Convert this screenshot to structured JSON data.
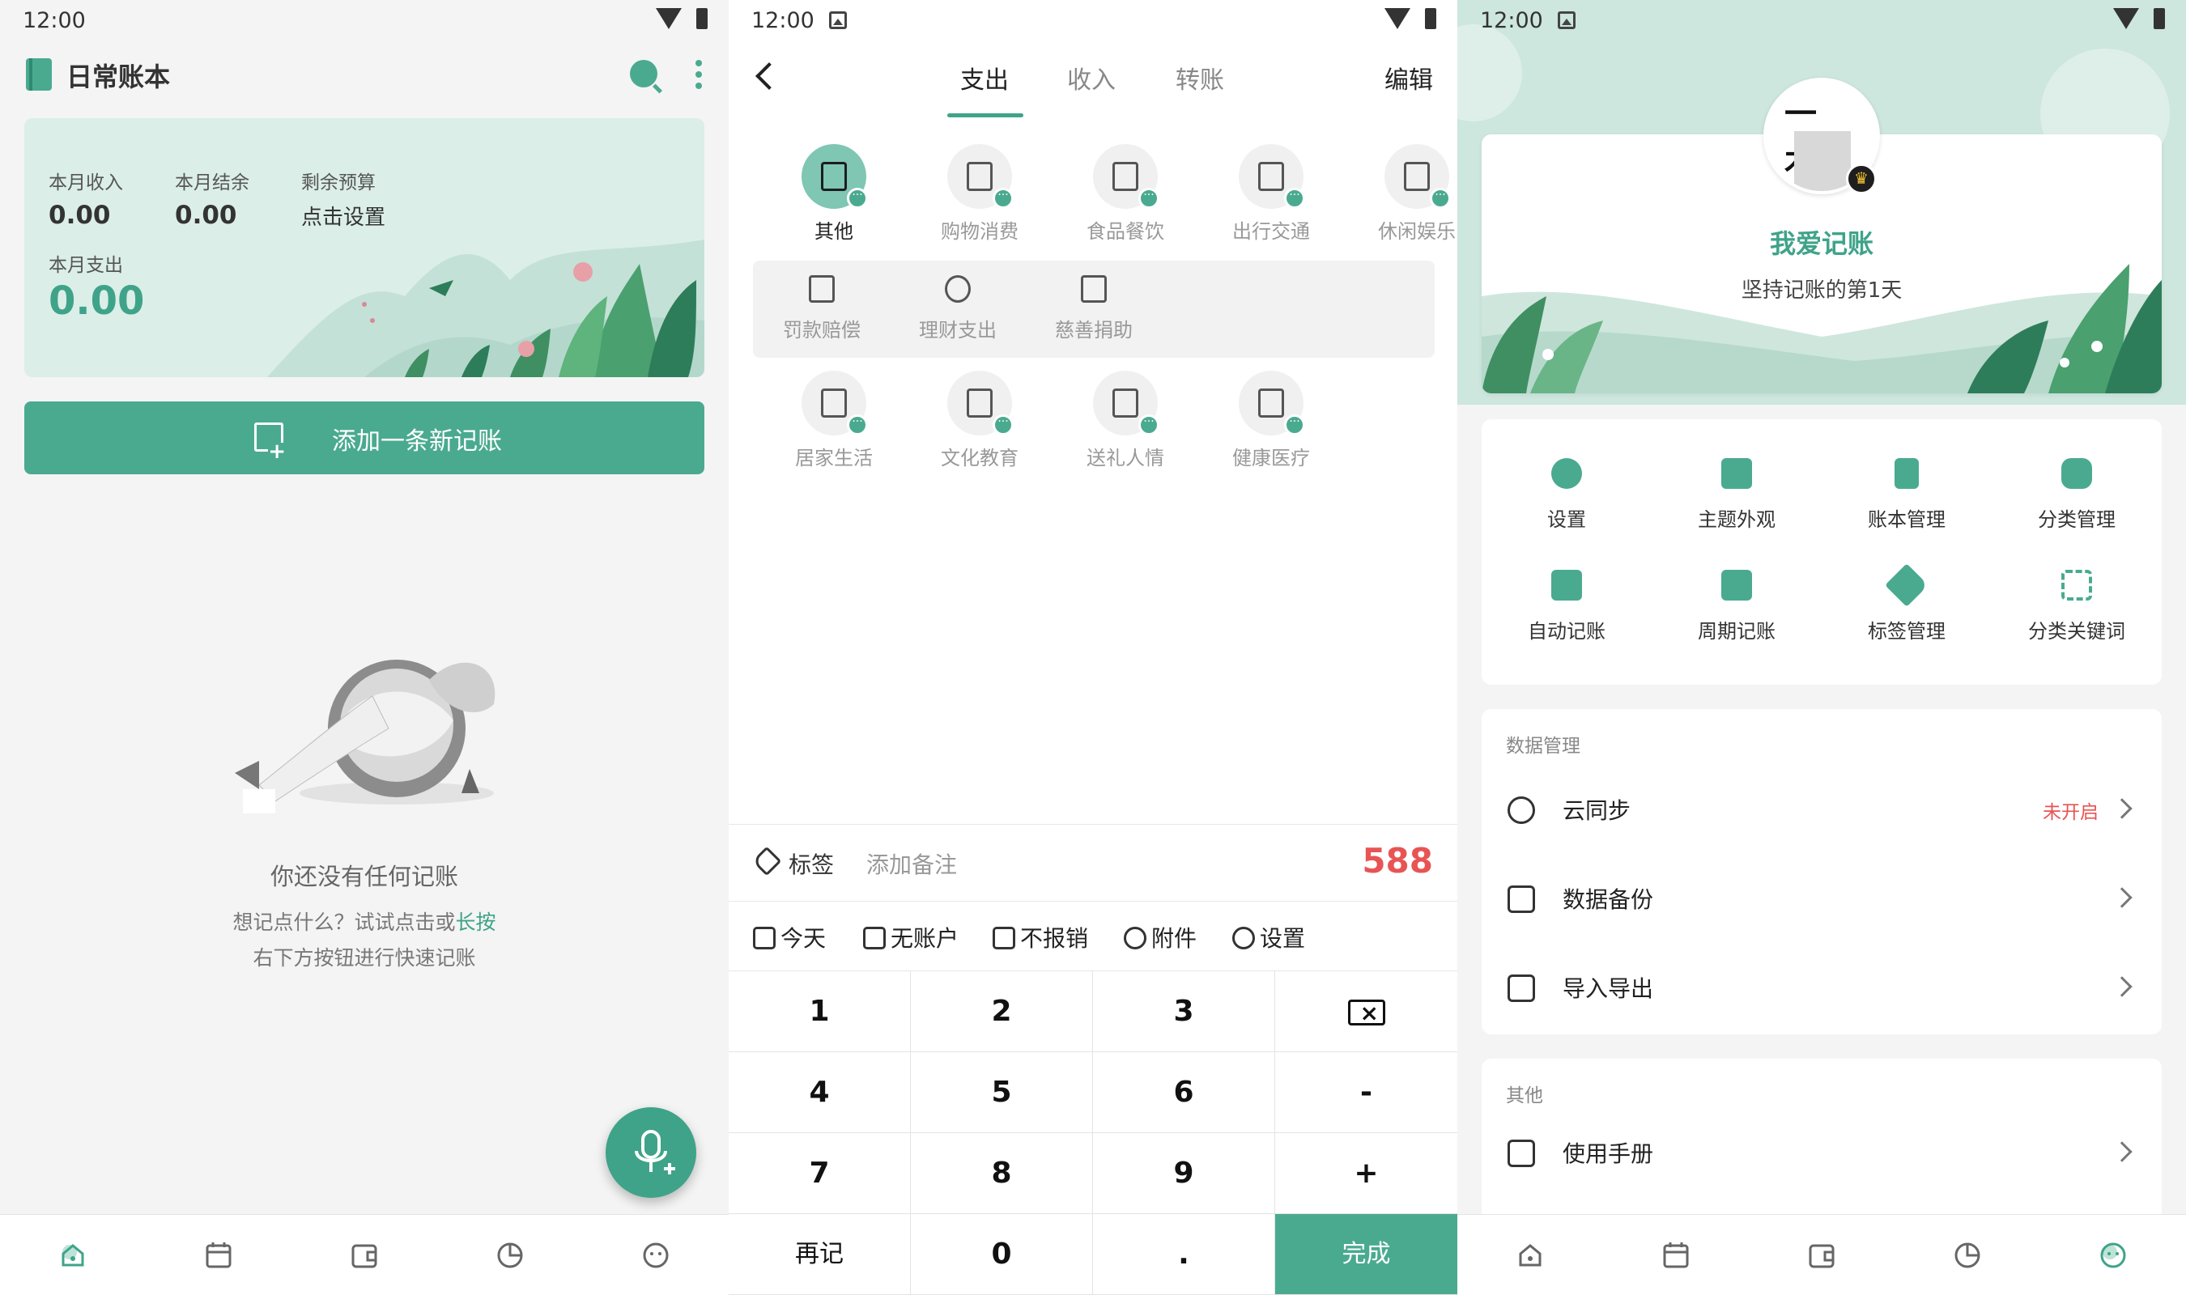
{
  "status": {
    "time": "12:00"
  },
  "colors": {
    "accent": "#4aaa8f",
    "amount": "#e85454",
    "bg": "#f4f4f4"
  },
  "home": {
    "title": "日常账本",
    "summary": {
      "income_label": "本月收入",
      "income_value": "0.00",
      "balance_label": "本月结余",
      "balance_value": "0.00",
      "budget_label": "剩余预算",
      "budget_value": "点击设置",
      "expense_label": "本月支出",
      "expense_value": "0.00"
    },
    "add_button": "添加一条新记账",
    "empty_title": "你还没有任何记账",
    "empty_hint_1": "想记点什么？试试点击或",
    "empty_hint_hl": "长按",
    "empty_hint_2": "右下方按钮进行快速记账"
  },
  "nav": {
    "items": [
      "home-icon",
      "calendar-icon",
      "wallet-icon",
      "chart-icon",
      "profile-icon"
    ]
  },
  "record": {
    "tabs": [
      "支出",
      "收入",
      "转账"
    ],
    "active_tab": "支出",
    "edit": "编辑",
    "categories_row1": [
      "其他",
      "购物消费",
      "食品餐饮",
      "出行交通",
      "休闲娱乐"
    ],
    "subcategories": [
      "罚款赔偿",
      "理财支出",
      "慈善捐助"
    ],
    "categories_row3": [
      "居家生活",
      "文化教育",
      "送礼人情",
      "健康医疗"
    ],
    "tag_label": "标签",
    "note_placeholder": "添加备注",
    "amount": "588",
    "options": [
      "今天",
      "无账户",
      "不报销",
      "附件",
      "设置"
    ],
    "keys": [
      "1",
      "2",
      "3",
      "",
      "4",
      "5",
      "6",
      "-",
      "7",
      "8",
      "9",
      "+",
      "再记",
      "0",
      ".",
      "完成"
    ]
  },
  "profile": {
    "avatar_text": "一木",
    "name": "我爱记账",
    "days": "坚持记账的第1天",
    "grid": [
      "设置",
      "主题外观",
      "账本管理",
      "分类管理",
      "自动记账",
      "周期记账",
      "标签管理",
      "分类关键词"
    ],
    "data_section": "数据管理",
    "data_rows": [
      "云同步",
      "数据备份",
      "导入导出"
    ],
    "sync_status": "未开启",
    "other_section": "其他",
    "other_rows": [
      "使用手册"
    ]
  }
}
